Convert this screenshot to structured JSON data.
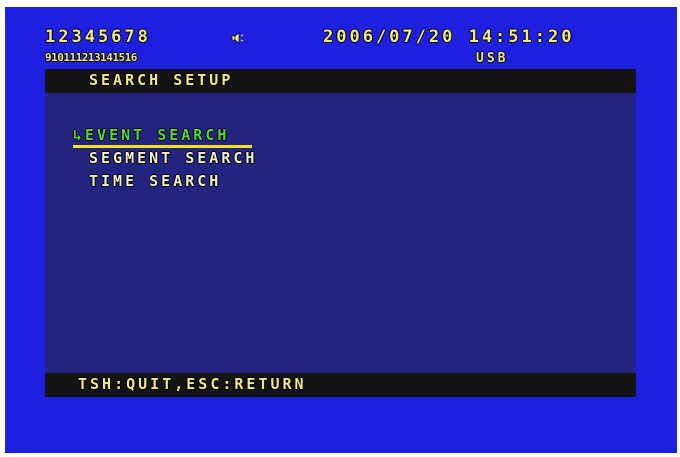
{
  "status": {
    "channels_row1": "12345678",
    "channels_row2": "910111213141516",
    "audio_icon": "speaker-icon",
    "datetime": "2006/07/20 14:51:20",
    "storage": "USB"
  },
  "menu": {
    "title": "SEARCH SETUP",
    "selected_marker": "↳",
    "items": [
      {
        "label": "EVENT SEARCH",
        "selected": true
      },
      {
        "label": "SEGMENT SEARCH",
        "selected": false
      },
      {
        "label": "TIME SEARCH",
        "selected": false
      }
    ]
  },
  "footer": {
    "hint": "TSH:QUIT,ESC:RETURN"
  },
  "colors": {
    "screen_bg": "#1f1fe0",
    "panel_bg": "#222480",
    "bar_bg": "#141414",
    "osd_text": "#f2e88a",
    "selected_text": "#52d83c",
    "selected_underline": "#f0e020"
  }
}
